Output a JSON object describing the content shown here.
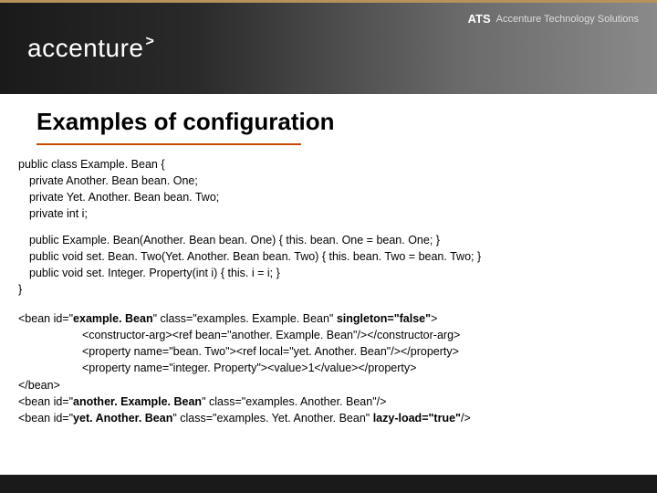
{
  "header": {
    "logo_text": "accenture",
    "logo_symbol": ">",
    "ats_label": "ATS",
    "ats_full": "Accenture Technology Solutions"
  },
  "title": "Examples of configuration",
  "java": {
    "l1": "public class Example. Bean {",
    "l2": "private Another. Bean bean. One;",
    "l3": "private Yet. Another. Bean bean. Two;",
    "l4": "private int i;",
    "l5": "public Example. Bean(Another. Bean bean. One) { this. bean. One = bean. One; }",
    "l6": "public void set. Bean. Two(Yet. Another. Bean bean. Two) { this. bean. Two = bean. Two; }",
    "l7": "public void set. Integer. Property(int i) { this. i = i; }",
    "l8": "}"
  },
  "xml": {
    "l1a": "<bean id=\"",
    "l1b": "example. Bean",
    "l1c": "\" class=\"examples. Example. Bean\" ",
    "l1d": "singleton=\"false\"",
    "l1e": ">",
    "l2": "<constructor-arg><ref bean=\"another. Example. Bean\"/></constructor-arg>",
    "l3": "<property name=\"bean. Two\"><ref local=\"yet. Another. Bean\"/></property>",
    "l4": "<property name=\"integer. Property\"><value>1</value></property>",
    "l5": "</bean>",
    "l6a": "<bean id=\"",
    "l6b": "another. Example. Bean",
    "l6c": "\" class=\"examples. Another. Bean\"/>",
    "l7a": "<bean id=\"",
    "l7b": "yet. Another. Bean",
    "l7c": "\" class=\"examples. Yet. Another. Bean\" ",
    "l7d": "lazy-load=\"true\"",
    "l7e": "/>"
  }
}
